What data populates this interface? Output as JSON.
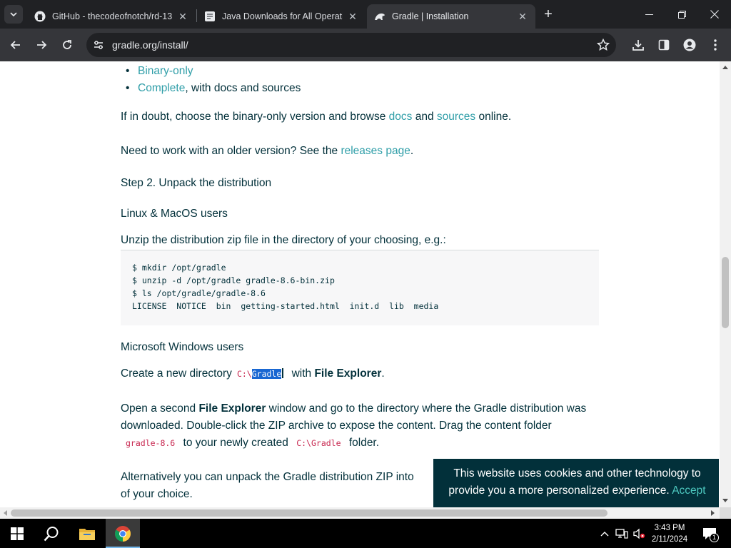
{
  "browser": {
    "tabs": [
      {
        "title": "GitHub - thecodeofnotch/rd-13",
        "favicon": "github-icon",
        "active": false
      },
      {
        "title": "Java Downloads for All Operati",
        "favicon": "java-icon",
        "active": false
      },
      {
        "title": "Gradle | Installation",
        "favicon": "gradle-icon",
        "active": true
      }
    ],
    "url": "gradle.org/install/"
  },
  "page": {
    "bullets": [
      {
        "link": "Binary-only",
        "rest": ""
      },
      {
        "link": "Complete",
        "rest": ", with docs and sources"
      }
    ],
    "doubt": {
      "pre": "If in doubt, choose the binary-only version and browse ",
      "docs": "docs",
      "mid": " and ",
      "sources": "sources",
      "post": " online."
    },
    "older": {
      "pre": "Need to work with an older version? See the ",
      "link": "releases page",
      "post": "."
    },
    "step2_heading": "Step 2. Unpack the distribution",
    "linux_heading": "Linux & MacOS users",
    "unzip_text": "Unzip the distribution zip file in the directory of your choosing, e.g.:",
    "code_lines": [
      "$ mkdir /opt/gradle",
      "$ unzip -d /opt/gradle gradle-8.6-bin.zip",
      "$ ls /opt/gradle/gradle-8.6",
      "LICENSE  NOTICE  bin  getting-started.html  init.d  lib  media"
    ],
    "windows_heading": "Microsoft Windows users",
    "create_dir": {
      "pre": "Create a new directory",
      "code_prefix": "C:\\",
      "code_selected": "Gradle",
      "mid": " with ",
      "bold": "File Explorer",
      "post": "."
    },
    "open_second": {
      "l1_pre": "Open a second ",
      "l1_bold": "File Explorer",
      "l1_post": " window and go to the directory where the Gradle distribution was",
      "l2": "downloaded. Double-click the ZIP archive to expose the content. Drag the content folder",
      "l3_code1": "gradle-8.6",
      "l3_mid": " to your newly created",
      "l3_code2": "C:\\Gradle",
      "l3_post": " folder."
    },
    "alt": {
      "l1": "Alternatively you can unpack the Gradle distribution ZIP into",
      "l2": "of your choice."
    }
  },
  "cookie_banner": {
    "line1": "This website uses cookies and other technology to",
    "line2": "provide you a more personalized experience.",
    "accept": "Accept"
  },
  "taskbar": {
    "time": "3:43 PM",
    "date": "2/11/2024",
    "notification_count": "1"
  }
}
